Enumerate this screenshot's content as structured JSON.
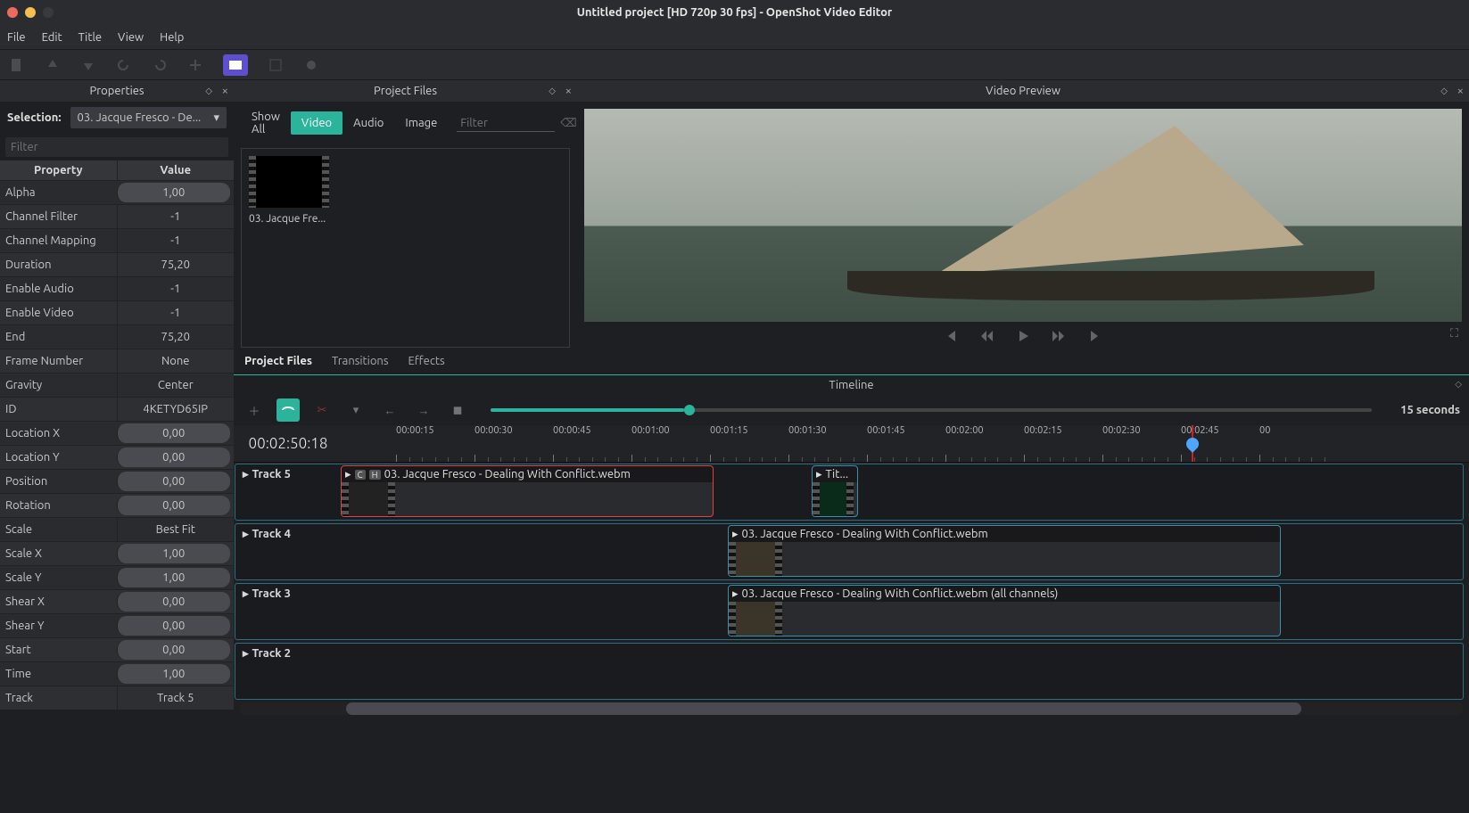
{
  "window": {
    "title": "Untitled project [HD 720p 30 fps] - OpenShot Video Editor"
  },
  "menu": {
    "file": "File",
    "edit": "Edit",
    "title": "Title",
    "view": "View",
    "help": "Help"
  },
  "panels": {
    "properties": "Properties",
    "projectFiles": "Project Files",
    "videoPreview": "Video Preview",
    "timeline": "Timeline"
  },
  "properties": {
    "selectionLabel": "Selection:",
    "selectionValue": "03. Jacque Fresco - De...",
    "filterPlaceholder": "Filter",
    "headProperty": "Property",
    "headValue": "Value",
    "rows": [
      {
        "k": "Alpha",
        "v": "1,00",
        "pill": true
      },
      {
        "k": "Channel Filter",
        "v": "-1"
      },
      {
        "k": "Channel Mapping",
        "v": "-1"
      },
      {
        "k": "Duration",
        "v": "75,20"
      },
      {
        "k": "Enable Audio",
        "v": "-1"
      },
      {
        "k": "Enable Video",
        "v": "-1"
      },
      {
        "k": "End",
        "v": "75,20"
      },
      {
        "k": "Frame Number",
        "v": "None"
      },
      {
        "k": "Gravity",
        "v": "Center"
      },
      {
        "k": "ID",
        "v": "4KETYD65IP"
      },
      {
        "k": "Location X",
        "v": "0,00",
        "pill": true
      },
      {
        "k": "Location Y",
        "v": "0,00",
        "pill": true
      },
      {
        "k": "Position",
        "v": "0,00",
        "pill": true
      },
      {
        "k": "Rotation",
        "v": "0,00",
        "pill": true
      },
      {
        "k": "Scale",
        "v": "Best Fit"
      },
      {
        "k": "Scale X",
        "v": "1,00",
        "pill": true
      },
      {
        "k": "Scale Y",
        "v": "1,00",
        "pill": true
      },
      {
        "k": "Shear X",
        "v": "0,00",
        "pill": true
      },
      {
        "k": "Shear Y",
        "v": "0,00",
        "pill": true
      },
      {
        "k": "Start",
        "v": "0,00",
        "pill": true
      },
      {
        "k": "Time",
        "v": "1,00",
        "pill": true
      },
      {
        "k": "Track",
        "v": "Track 5"
      }
    ]
  },
  "filesTabs": {
    "showAll": "Show All",
    "video": "Video",
    "audio": "Audio",
    "image": "Image",
    "filterPlaceholder": "Filter"
  },
  "files": {
    "item0": "03. Jacque Fre..."
  },
  "midTabs": {
    "projectFiles": "Project Files",
    "transitions": "Transitions",
    "effects": "Effects"
  },
  "timeline": {
    "zoomLabel": "15 seconds",
    "timecode": "00:02:50:18",
    "ticks": [
      "00:00:15",
      "00:00:30",
      "00:00:45",
      "00:01:00",
      "00:01:15",
      "00:01:30",
      "00:01:45",
      "00:02:00",
      "00:02:15",
      "00:02:30",
      "00:02:45",
      "00"
    ],
    "tracks": {
      "t5": "Track 5",
      "t4": "Track 4",
      "t3": "Track 3",
      "t2": "Track 2"
    },
    "clips": {
      "c1": "03. Jacque Fresco - Dealing With Conflict.webm",
      "c2": "Tit...",
      "c3": "03. Jacque Fresco - Dealing With Conflict.webm",
      "c4": "03. Jacque Fresco - Dealing With Conflict.webm (all channels)"
    },
    "badges": {
      "c": "C",
      "h": "H"
    }
  }
}
